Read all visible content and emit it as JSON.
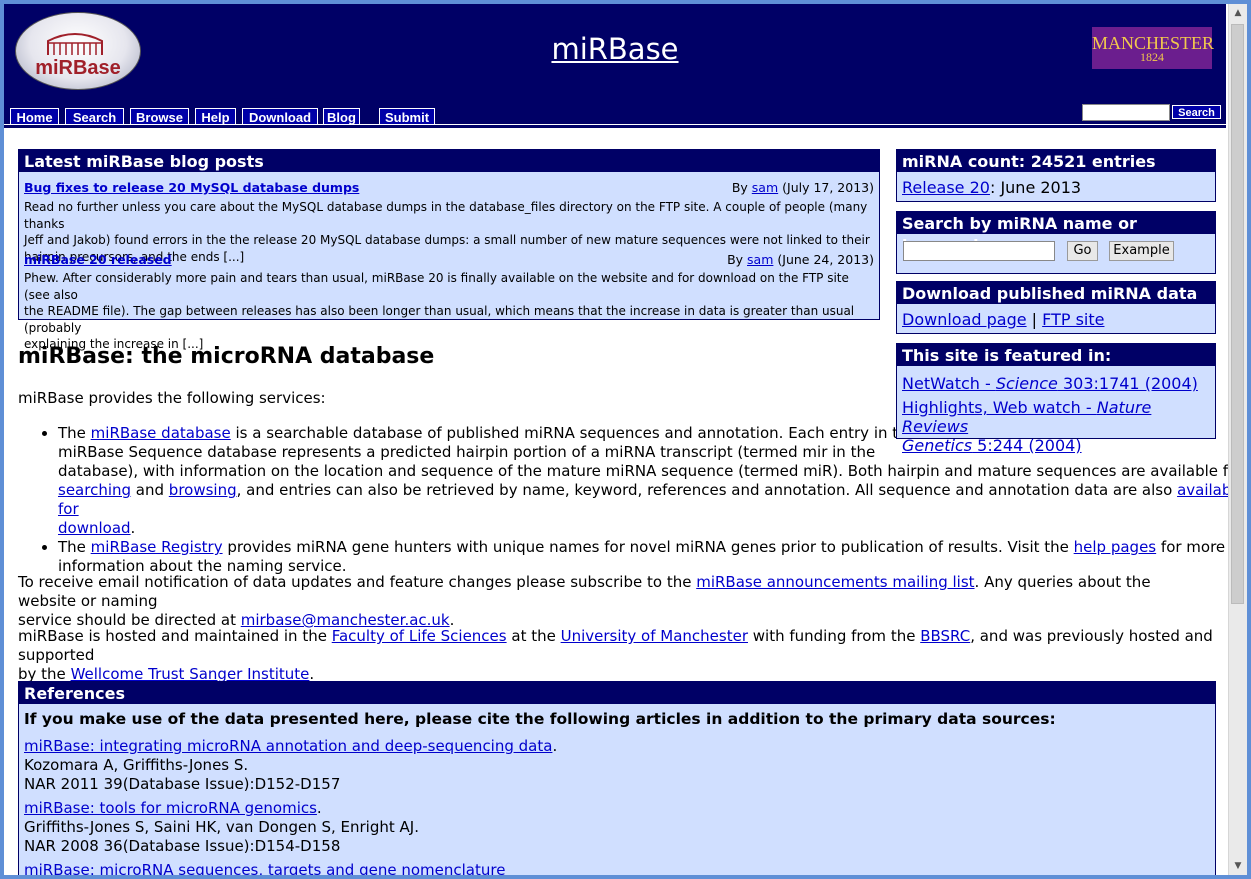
{
  "header": {
    "site_title": "miRBase",
    "logo_text": "miRBase",
    "manchester_name": "MANCHESTER",
    "manchester_year": "1824"
  },
  "nav": {
    "items": [
      "Home",
      "Search",
      "Browse",
      "Help",
      "Download",
      "Blog",
      "Submit"
    ],
    "search_button": "Search",
    "search_value": ""
  },
  "blog": {
    "heading": "Latest miRBase blog posts",
    "posts": [
      {
        "title": "Bug fixes to release 20 MySQL database dumps",
        "by": "By",
        "author": "sam",
        "date": "(July 17, 2013)",
        "line1": "Read no further unless you care about the MySQL database dumps in the database_files directory on the FTP site. A couple of people (many thanks",
        "line2": "Jeff and Jakob) found errors in the the release 20 MySQL database dumps: a small number of new mature sequences were not linked to their",
        "line3": "hairpin precursors, and the ends [...]"
      },
      {
        "title": "miRBase 20 released",
        "by": "By",
        "author": "sam",
        "date": "(June 24, 2013)",
        "line1": "Phew. After considerably more pain and tears than usual, miRBase 20 is finally available on the website and for download on the FTP site (see also",
        "line2": "the README file). The gap between releases has also been longer than usual, which means that the increase in data is greater than usual (probably",
        "line3": "explaining the increase in [...]"
      }
    ]
  },
  "main": {
    "title": "miRBase: the microRNA database",
    "intro": "miRBase provides the following services:",
    "service1": {
      "t1": "The ",
      "l1": "miRBase database",
      "t2": " is a searchable database of published miRNA sequences and annotation. Each entry in the",
      "t3": "miRBase Sequence database represents a predicted hairpin portion of a miRNA transcript (termed mir in the",
      "t4": "database), with information on the location and sequence of the mature miRNA sequence (termed miR). Both hairpin and mature sequences are available for",
      "l2": "searching",
      "t5": " and ",
      "l3": "browsing",
      "t6": ", and entries can also be retrieved by name, keyword, references and annotation. All sequence and annotation data are also ",
      "l4a": "available for",
      "l4b": "download",
      "t7": "."
    },
    "service2": {
      "t1": "The ",
      "l1": "miRBase Registry",
      "t2": " provides miRNA gene hunters with unique names for novel miRNA genes prior to publication of results. Visit the ",
      "l2": "help pages",
      "t3": " for more",
      "t4": "information about the naming service."
    },
    "notify": {
      "t1": "To receive email notification of data updates and feature changes please subscribe to the ",
      "l1": "miRBase announcements mailing list",
      "t2": ". Any queries about the website or naming",
      "t3": "service should be directed at ",
      "l2": "mirbase@manchester.ac.uk",
      "t4": "."
    },
    "hosted": {
      "t1": "miRBase is hosted and maintained in the ",
      "l1": "Faculty of Life Sciences",
      "t2": " at the ",
      "l2": "University of Manchester",
      "t3": " with funding from the ",
      "l3": "BBSRC",
      "t4": ", and was previously hosted and supported",
      "t5": "by the ",
      "l4": "Wellcome Trust Sanger Institute",
      "t6": "."
    }
  },
  "sidebar": {
    "count_heading": "miRNA count: 24521 entries",
    "release_link": "Release 20",
    "release_date": ": June 2013",
    "search_heading": "Search by miRNA name or keyword",
    "search_value": "",
    "go_button": "Go",
    "example_button": "Example",
    "download_heading": "Download published miRNA data",
    "download_page": "Download page",
    "separator": " | ",
    "ftp_site": "FTP site",
    "featured_heading": "This site is featured in:",
    "feat1_a": "NetWatch - ",
    "feat1_b": "Science",
    "feat1_c": " 303:1741 (2004)",
    "feat2_a": "Highlights, Web watch - ",
    "feat2_b": "Nature Reviews",
    "feat2_c": "Genetics",
    "feat2_d": " 5:244 (2004)"
  },
  "references": {
    "heading": "References",
    "intro": "If you make use of the data presented here, please cite the following articles in addition to the primary data sources:",
    "items": [
      {
        "title": "miRBase: integrating microRNA annotation and deep-sequencing data",
        "authors": "Kozomara A, Griffiths-Jones S.",
        "journal": "NAR 2011 39(Database Issue):D152-D157"
      },
      {
        "title": "miRBase: tools for microRNA genomics",
        "authors": "Griffiths-Jones S, Saini HK, van Dongen S, Enright AJ.",
        "journal": "NAR 2008 36(Database Issue):D154-D158"
      },
      {
        "title": "miRBase: microRNA sequences, targets and gene nomenclature"
      }
    ]
  }
}
